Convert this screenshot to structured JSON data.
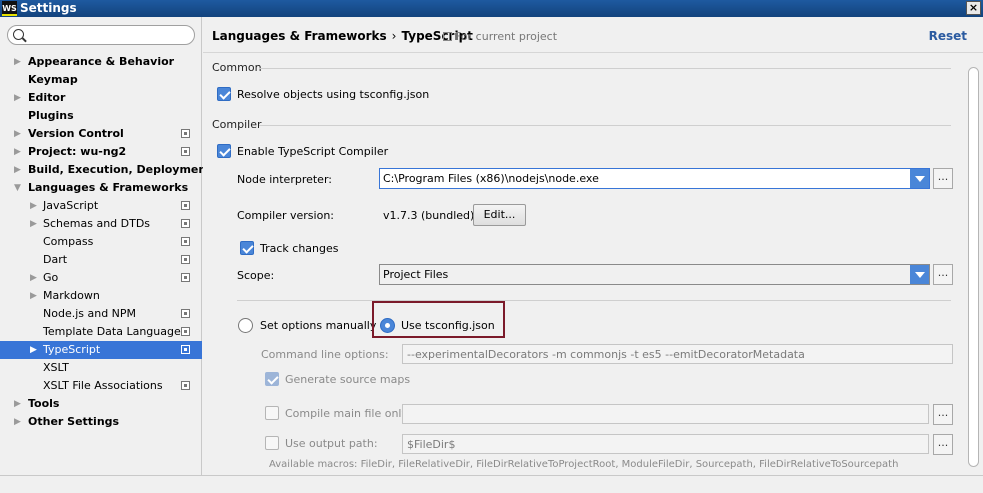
{
  "window": {
    "title": "Settings",
    "logo_text": "WS",
    "close_label": "×"
  },
  "sidebar": {
    "items": [
      {
        "label": "Appearance & Behavior",
        "level": 0,
        "arrow": "▶",
        "project": false
      },
      {
        "label": "Keymap",
        "level": 0,
        "arrow": "",
        "project": false
      },
      {
        "label": "Editor",
        "level": 0,
        "arrow": "▶",
        "project": false
      },
      {
        "label": "Plugins",
        "level": 0,
        "arrow": "",
        "project": false
      },
      {
        "label": "Version Control",
        "level": 0,
        "arrow": "▶",
        "project": true
      },
      {
        "label": "Project: wu-ng2",
        "level": 0,
        "arrow": "▶",
        "project": true
      },
      {
        "label": "Build, Execution, Deployment",
        "level": 0,
        "arrow": "▶",
        "project": false
      },
      {
        "label": "Languages & Frameworks",
        "level": 0,
        "arrow": "▼",
        "project": false
      },
      {
        "label": "JavaScript",
        "level": 1,
        "arrow": "▶",
        "project": true
      },
      {
        "label": "Schemas and DTDs",
        "level": 1,
        "arrow": "▶",
        "project": true
      },
      {
        "label": "Compass",
        "level": 1,
        "arrow": "",
        "project": true
      },
      {
        "label": "Dart",
        "level": 1,
        "arrow": "",
        "project": true
      },
      {
        "label": "Go",
        "level": 1,
        "arrow": "▶",
        "project": true
      },
      {
        "label": "Markdown",
        "level": 1,
        "arrow": "▶",
        "project": false
      },
      {
        "label": "Node.js and NPM",
        "level": 1,
        "arrow": "",
        "project": true
      },
      {
        "label": "Template Data Languages",
        "level": 1,
        "arrow": "",
        "project": true
      },
      {
        "label": "TypeScript",
        "level": 1,
        "arrow": "▶",
        "project": true,
        "selected": true
      },
      {
        "label": "XSLT",
        "level": 1,
        "arrow": "",
        "project": false
      },
      {
        "label": "XSLT File Associations",
        "level": 1,
        "arrow": "",
        "project": true
      },
      {
        "label": "Tools",
        "level": 0,
        "arrow": "▶",
        "project": false
      },
      {
        "label": "Other Settings",
        "level": 0,
        "arrow": "▶",
        "project": false
      }
    ]
  },
  "header": {
    "breadcrumb_parent": "Languages & Frameworks",
    "breadcrumb_sep": "›",
    "breadcrumb_current": "TypeScript",
    "scope_hint": "For current project",
    "reset_label": "Reset"
  },
  "common": {
    "section_title": "Common",
    "resolve_objects_label": "Resolve objects using tsconfig.json",
    "resolve_objects_checked": true
  },
  "compiler": {
    "section_title": "Compiler",
    "enable_label": "Enable TypeScript Compiler",
    "enable_checked": true,
    "node_interpreter_label": "Node interpreter:",
    "node_interpreter_value": "C:\\Program Files (x86)\\nodejs\\node.exe",
    "compiler_version_label": "Compiler version:",
    "compiler_version_value": "v1.7.3 (bundled)",
    "edit_button_label": "Edit...",
    "track_changes_label": "Track changes",
    "track_changes_checked": true,
    "scope_label": "Scope:",
    "scope_value": "Project Files",
    "set_manually_label": "Set options manually",
    "use_tsconfig_label": "Use tsconfig.json",
    "selected_mode": "use_tsconfig",
    "command_line_label": "Command line options:",
    "command_line_value": "--experimentalDecorators -m commonjs -t es5 --emitDecoratorMetadata",
    "generate_maps_label": "Generate source maps",
    "generate_maps_checked": true,
    "compile_main_label": "Compile main file only:",
    "compile_main_value": "",
    "use_output_label": "Use output path:",
    "use_output_value": "$FileDir$",
    "macros_text": "Available macros: FileDir, FileRelativeDir, FileDirRelativeToProjectRoot, ModuleFileDir, Sourcepath, FileDirRelativeToSourcepath",
    "ellipsis_label": "..."
  }
}
